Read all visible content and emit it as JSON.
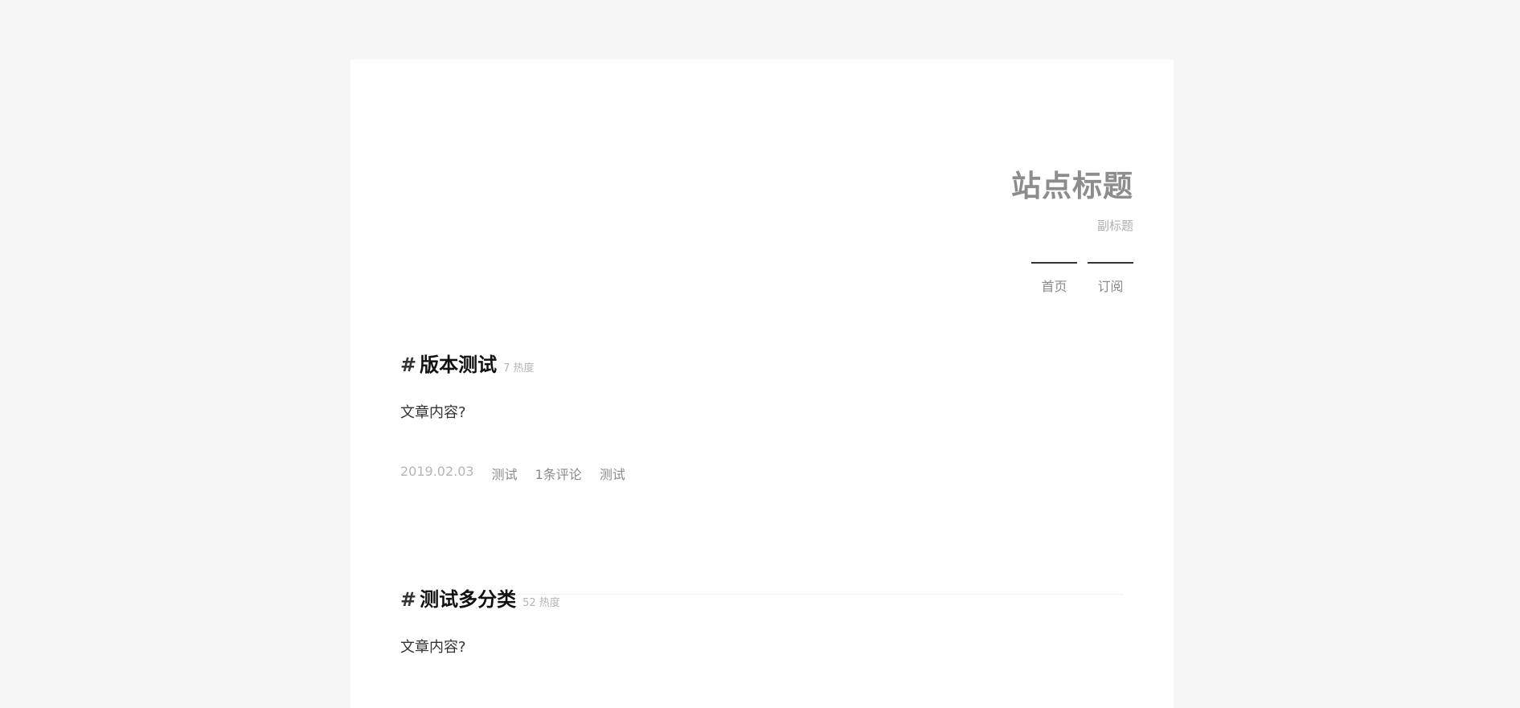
{
  "site": {
    "title": "站点标题",
    "subtitle": "副标题"
  },
  "nav": {
    "items": [
      {
        "label": "首页"
      },
      {
        "label": "订阅"
      }
    ]
  },
  "posts": [
    {
      "hash": "#",
      "title": "版本测试",
      "heat": "7 热度",
      "content": "文章内容?",
      "date": "2019.02.03",
      "category": "测试",
      "comments": "1条评论",
      "tag": "测试"
    },
    {
      "hash": "#",
      "title": "测试多分类",
      "heat": "52 热度",
      "content": "文章内容?"
    }
  ]
}
